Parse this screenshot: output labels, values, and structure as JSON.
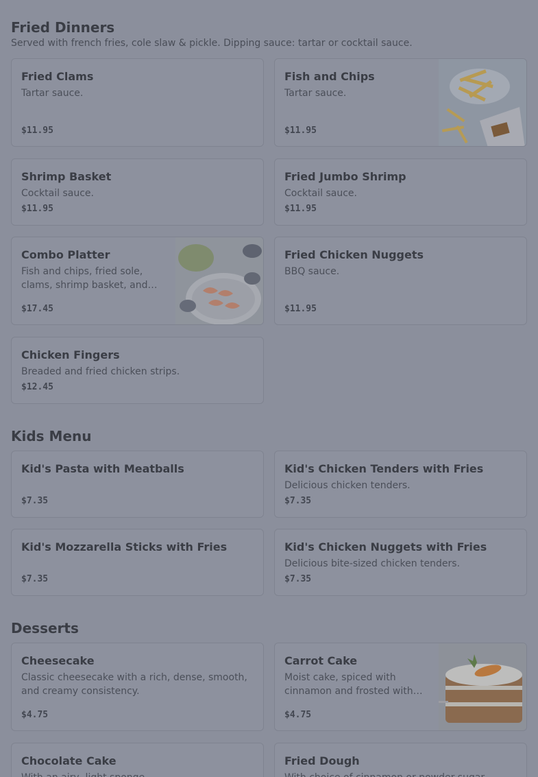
{
  "sections": {
    "fried": {
      "title": "Fried Dinners",
      "description": "Served with french fries, cole slaw & pickle. Dipping sauce: tartar or cocktail sauce.",
      "items": [
        {
          "name": "Fried Clams",
          "desc": "Tartar sauce.",
          "price": "$11.95"
        },
        {
          "name": "Fish and Chips",
          "desc": "Tartar sauce.",
          "price": "$11.95",
          "image": "fries-and-fish-photo"
        },
        {
          "name": "Shrimp Basket",
          "desc": "Cocktail sauce.",
          "price": "$11.95"
        },
        {
          "name": "Fried Jumbo Shrimp",
          "desc": "Cocktail sauce.",
          "price": "$11.95"
        },
        {
          "name": "Combo Platter",
          "desc": "Fish and chips, fried sole, clams, shrimp basket, and…",
          "price": "$17.45",
          "image": "seafood-platter-photo"
        },
        {
          "name": "Fried Chicken Nuggets",
          "desc": "BBQ sauce.",
          "price": "$11.95"
        },
        {
          "name": "Chicken Fingers",
          "desc": "Breaded and fried chicken strips.",
          "price": "$12.45"
        }
      ]
    },
    "kids": {
      "title": "Kids Menu",
      "items": [
        {
          "name": "Kid's Pasta with Meatballs",
          "desc": "",
          "price": "$7.35"
        },
        {
          "name": "Kid's Chicken Tenders with Fries",
          "desc": "Delicious chicken tenders.",
          "price": "$7.35"
        },
        {
          "name": "Kid's Mozzarella Sticks with Fries",
          "desc": "",
          "price": "$7.35"
        },
        {
          "name": "Kid's Chicken Nuggets with Fries",
          "desc": "Delicious bite-sized chicken tenders.",
          "price": "$7.35"
        }
      ]
    },
    "desserts": {
      "title": "Desserts",
      "items": [
        {
          "name": "Cheesecake",
          "desc": "Classic cheesecake with a rich, dense, smooth, and creamy consistency.",
          "price": "$4.75"
        },
        {
          "name": "Carrot Cake",
          "desc": "Moist cake, spiced with cinnamon and frosted with…",
          "price": "$4.75",
          "image": "carrot-cake-photo"
        },
        {
          "name": "Chocolate Cake",
          "desc": "With an airy, light sponge.",
          "price": ""
        },
        {
          "name": "Fried Dough",
          "desc": "With choice of cinnamon or powder sugar.",
          "price": ""
        }
      ]
    }
  },
  "colors": {
    "overlay_bg": "#8b8f9c",
    "card_bg": "#8d919e",
    "text_dark": "#3a3d45"
  }
}
